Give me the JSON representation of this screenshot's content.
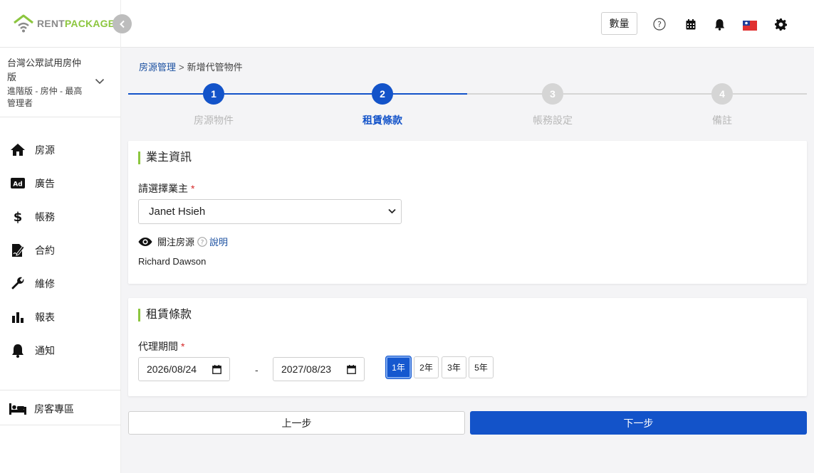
{
  "brand": {
    "name_part1": "RENT",
    "name_part2": "PACKAGE",
    "green": "#8cc63f",
    "gray": "#8a8a8a"
  },
  "account": {
    "name": "台灣公眾試用房仲版",
    "role": "進階版 - 房仲 - 最高管理者"
  },
  "sidebar": {
    "items": [
      {
        "label": "房源",
        "icon": "home-icon"
      },
      {
        "label": "廣告",
        "icon": "ad-icon"
      },
      {
        "label": "帳務",
        "icon": "dollar-icon"
      },
      {
        "label": "合約",
        "icon": "contract-icon"
      },
      {
        "label": "維修",
        "icon": "wrench-icon"
      },
      {
        "label": "報表",
        "icon": "bar-chart-icon"
      },
      {
        "label": "通知",
        "icon": "bell-icon"
      }
    ],
    "tenant_area": {
      "label": "房客專區",
      "icon": "bed-icon"
    }
  },
  "header": {
    "quantity_label": "數量",
    "icons": [
      "help-icon",
      "calendar-icon",
      "bell-icon",
      "taiwan-flag-icon",
      "gear-icon"
    ]
  },
  "breadcrumb": {
    "parent": "房源管理",
    "separator": ">",
    "current": "新增代管物件"
  },
  "stepper": {
    "active_color": "#1353c9",
    "inactive_color": "#d5d5d5",
    "steps": [
      {
        "number": "1",
        "label": "房源物件",
        "state": "done"
      },
      {
        "number": "2",
        "label": "租賃條款",
        "state": "active"
      },
      {
        "number": "3",
        "label": "帳務設定",
        "state": "todo"
      },
      {
        "number": "4",
        "label": "備註",
        "state": "todo"
      }
    ]
  },
  "owner_section": {
    "title": "業主資訊",
    "owner_label": "請選擇業主",
    "required_mark": "*",
    "owner_value": "Janet Hsieh",
    "watch_label": "關注房源",
    "explain_link": "說明",
    "watcher": "Richard Dawson"
  },
  "lease_section": {
    "title": "租賃條款",
    "period_label": "代理期間",
    "required_mark": "*",
    "start_date": "2026/08/24",
    "end_date": "2027/08/23",
    "dash": "-",
    "year_options": [
      {
        "label": "1年",
        "active": true
      },
      {
        "label": "2年",
        "active": false
      },
      {
        "label": "3年",
        "active": false
      },
      {
        "label": "5年",
        "active": false
      }
    ]
  },
  "actions": {
    "prev_label": "上一步",
    "next_label": "下一步"
  }
}
